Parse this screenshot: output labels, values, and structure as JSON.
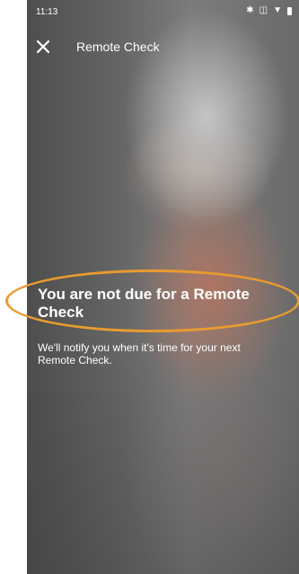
{
  "status_bar": {
    "time": "11:13",
    "icons": [
      "bluetooth-icon",
      "vibrate-icon",
      "wifi-icon",
      "battery-icon"
    ]
  },
  "app_bar": {
    "title": "Remote Check",
    "close_icon": "close-icon"
  },
  "message": {
    "headline": "You are not due for a Remote Check",
    "body": "We'll notify you when it's time for your next Remote Check."
  },
  "colors": {
    "highlight": "#e89b2f",
    "text": "#ffffff"
  }
}
